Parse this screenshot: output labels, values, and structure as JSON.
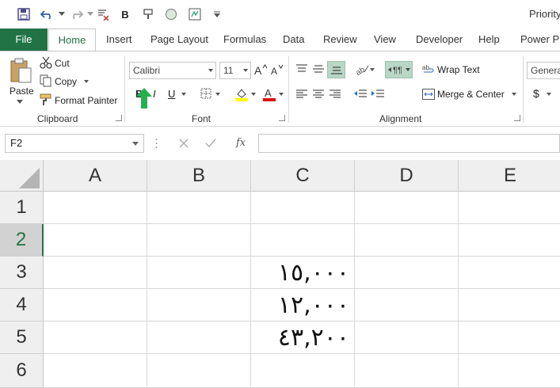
{
  "app": {
    "title": "Priority"
  },
  "ribbon_tabs": [
    "File",
    "Home",
    "Insert",
    "Page Layout",
    "Formulas",
    "Data",
    "Review",
    "View",
    "Developer",
    "Help",
    "Power Piv"
  ],
  "clipboard": {
    "paste": "Paste",
    "cut": "Cut",
    "copy": "Copy",
    "format_painter": "Format Painter",
    "group_label": "Clipboard"
  },
  "font": {
    "family": "Calibri",
    "size": "11",
    "bold": "B",
    "italic": "I",
    "underline": "U",
    "group_label": "Font"
  },
  "alignment": {
    "wrap_text": "Wrap Text",
    "merge_center": "Merge & Center",
    "group_label": "Alignment"
  },
  "number": {
    "format": "Genera",
    "currency": "$"
  },
  "formula_bar": {
    "name_box": "F2",
    "fx": "fx",
    "formula": ""
  },
  "grid": {
    "columns": [
      "A",
      "B",
      "C",
      "D",
      "E"
    ],
    "rows": [
      "1",
      "2",
      "3",
      "4",
      "5",
      "6"
    ],
    "selected_row": "2",
    "values": {
      "C3": "١٥,٠٠٠",
      "C4": "١٢,٠٠٠",
      "C5": "٤٣,٢٠٠"
    }
  },
  "colors": {
    "accent": "#217346",
    "arrow": "#22b14c"
  },
  "icons": {
    "save": "save-icon",
    "undo": "undo-icon",
    "redo": "redo-icon",
    "arrow": "green-up-arrow-icon"
  }
}
